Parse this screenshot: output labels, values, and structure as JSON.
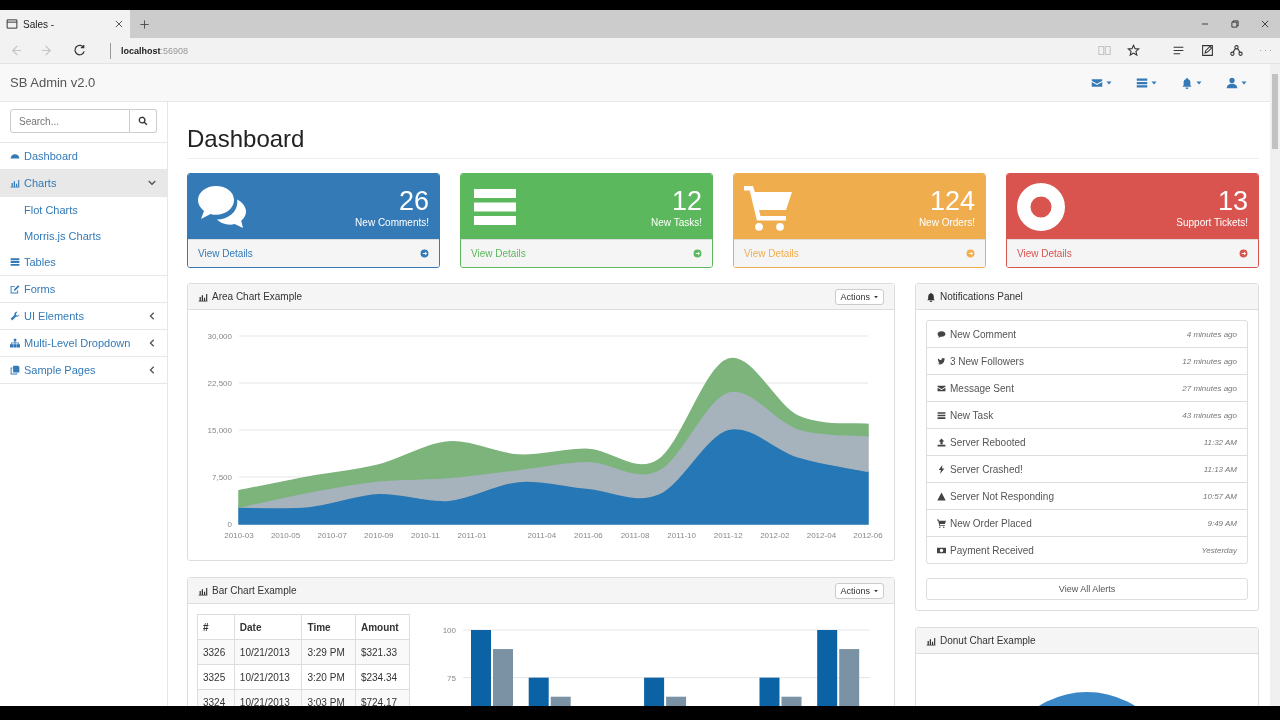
{
  "browser": {
    "tab": {
      "title": "Sales -"
    },
    "address": "**localhost**:56908",
    "nav_buttons": [
      {
        "disabled": true
      },
      {
        "disabled": true
      },
      {
        "disabled": false
      }
    ],
    "toolbar_buttons": [
      {
        "disabled": true
      },
      {
        "disabled": false
      },
      {
        "disabled": false
      },
      {
        "disabled": false
      },
      {
        "disabled": false
      },
      {
        "disabled": false
      }
    ]
  },
  "navbar": {
    "brand": "SB Admin v2.0"
  },
  "sidebar": {
    "search": {
      "placeholder": "Search..."
    },
    "items": [
      {
        "label": "Dashboard",
        "selected": false,
        "expandable": false
      },
      {
        "label": "Charts",
        "selected": true,
        "expandable": true,
        "expanded": true,
        "children": [
          {
            "label": "Flot Charts"
          },
          {
            "label": "Morris.js Charts"
          }
        ]
      },
      {
        "label": "Tables",
        "selected": false,
        "expandable": false
      },
      {
        "label": "Forms",
        "selected": false,
        "expandable": false
      },
      {
        "label": "UI Elements",
        "selected": false,
        "expandable": true,
        "expanded": false
      },
      {
        "label": "Multi-Level Dropdown",
        "selected": false,
        "expandable": true,
        "expanded": false
      },
      {
        "label": "Sample Pages",
        "selected": false,
        "expandable": true,
        "expanded": false
      }
    ]
  },
  "page": {
    "title": "Dashboard"
  },
  "stat_cards": [
    {
      "count": "26",
      "label": "New Comments!",
      "link": "View Details",
      "color": "#337ab7"
    },
    {
      "count": "12",
      "label": "New Tasks!",
      "link": "View Details",
      "color": "#5cb85c"
    },
    {
      "count": "124",
      "label": "New Orders!",
      "link": "View Details",
      "color": "#f0ad4e"
    },
    {
      "count": "13",
      "label": "Support Tickets!",
      "link": "View Details",
      "color": "#d9534f"
    }
  ],
  "area_panel": {
    "title": "Area Chart Example",
    "actions": "Actions",
    "chart_data": {
      "type": "area",
      "stacked": true,
      "grid": true,
      "ylim": [
        0,
        30000
      ],
      "categories": [
        "2010-03",
        null,
        "2010-05",
        null,
        "2010-07",
        null,
        "2010-09",
        null,
        "2010-11",
        null,
        "2011-01",
        null,
        null,
        "2011-04",
        null,
        "2011-06",
        null,
        "2011-08",
        null,
        "2011-10",
        null,
        "2011-12",
        null,
        "2012-02",
        null,
        "2012-04",
        null,
        "2012-06"
      ],
      "yticks": [
        {
          "value": 0,
          "label": "0"
        },
        {
          "value": 7500,
          "label": "7,500"
        },
        {
          "value": 15000,
          "label": "15,000"
        },
        {
          "value": 22500,
          "label": "22,500"
        },
        {
          "value": 30000,
          "label": "30,000"
        }
      ],
      "series": [
        {
          "color": "#2577b5",
          "values": [
            2700,
            null,
            null,
            2800,
            null,
            null,
            4900,
            null,
            null,
            3800,
            null,
            null,
            6800,
            null,
            null,
            5700,
            null,
            null,
            4800,
            null,
            null,
            15100,
            null,
            null,
            10700,
            null,
            null,
            8400
          ]
        },
        {
          "color": "#a7b3bc",
          "values": [
            0,
            null,
            null,
            2300,
            null,
            null,
            2000,
            null,
            null,
            3600,
            null,
            null,
            1900,
            null,
            null,
            4300,
            null,
            null,
            3800,
            null,
            null,
            6000,
            null,
            null,
            4500,
            null,
            null,
            5700
          ]
        },
        {
          "color": "#7cb47c",
          "values": [
            2600,
            null,
            null,
            2400,
            null,
            null,
            2500,
            null,
            null,
            5700,
            null,
            null,
            2300,
            null,
            null,
            1900,
            null,
            null,
            1600,
            null,
            null,
            5200,
            null,
            null,
            2000,
            null,
            null,
            1800
          ]
        }
      ]
    }
  },
  "bar_panel": {
    "title": "Bar Chart Example",
    "actions": "Actions",
    "table": {
      "columns": [
        "#",
        "Date",
        "Time",
        "Amount"
      ],
      "rows": [
        [
          "3326",
          "10/21/2013",
          "3:29 PM",
          "$321.33"
        ],
        [
          "3325",
          "10/21/2013",
          "3:20 PM",
          "$234.34"
        ],
        [
          "3324",
          "10/21/2013",
          "3:03 PM",
          "$724.17"
        ]
      ]
    },
    "chart_data": {
      "type": "bar",
      "ylim": [
        57.5,
        100
      ],
      "yticks": [
        75,
        100
      ],
      "series": [
        {
          "color": "#0b62a4",
          "values": [
            100,
            75,
            null,
            75,
            null,
            75,
            100
          ]
        },
        {
          "color": "#7a92a3",
          "values": [
            90,
            65,
            null,
            65,
            null,
            65,
            90
          ]
        }
      ]
    }
  },
  "notifications_panel": {
    "title": "Notifications Panel",
    "items": [
      {
        "text": "New Comment",
        "time": "4 minutes ago"
      },
      {
        "text": "3 New Followers",
        "time": "12 minutes ago"
      },
      {
        "text": "Message Sent",
        "time": "27 minutes ago"
      },
      {
        "text": "New Task",
        "time": "43 minutes ago"
      },
      {
        "text": "Server Rebooted",
        "time": "11:32 AM"
      },
      {
        "text": "Server Crashed!",
        "time": "11:13 AM"
      },
      {
        "text": "Server Not Responding",
        "time": "10:57 AM"
      },
      {
        "text": "New Order Placed",
        "time": "9:49 AM"
      },
      {
        "text": "Payment Received",
        "time": "Yesterday"
      }
    ],
    "button": "View All Alerts"
  },
  "donut_panel": {
    "title": "Donut Chart Example"
  }
}
